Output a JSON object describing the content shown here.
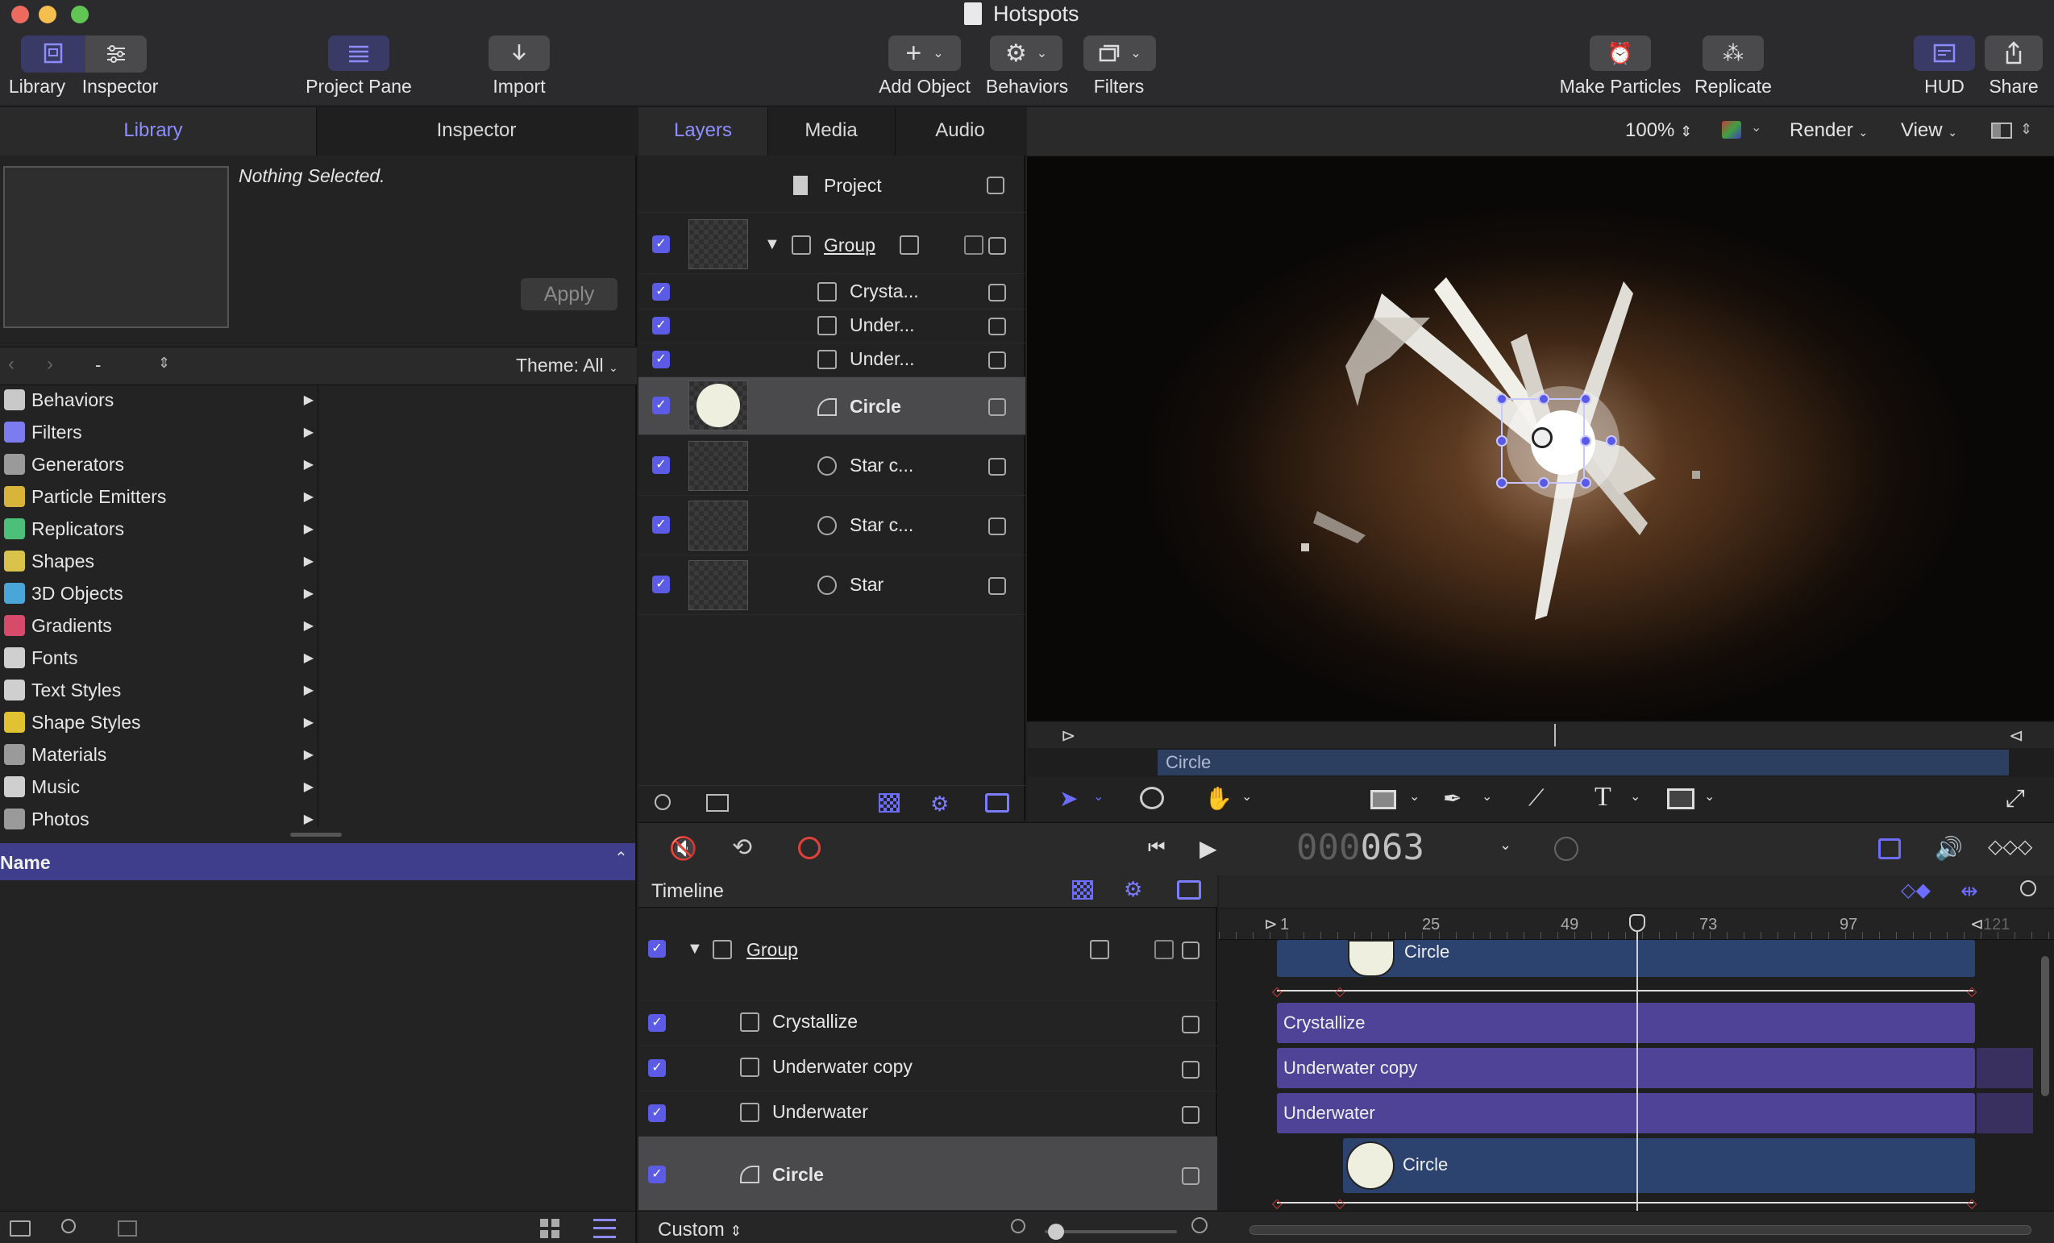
{
  "window": {
    "title": "Hotspots"
  },
  "toolbar": {
    "library": "Library",
    "inspector": "Inspector",
    "project_pane": "Project Pane",
    "import": "Import",
    "add_object": "Add Object",
    "behaviors": "Behaviors",
    "filters": "Filters",
    "make_particles": "Make Particles",
    "replicate": "Replicate",
    "hud": "HUD",
    "share": "Share"
  },
  "left_tabs": {
    "library": "Library",
    "inspector": "Inspector"
  },
  "preview": {
    "status": "Nothing Selected.",
    "apply": "Apply"
  },
  "browser": {
    "path": "-",
    "theme": "Theme: All"
  },
  "library_items": [
    {
      "label": "Behaviors",
      "icon": "gear-icon",
      "color": "#c9c9c9"
    },
    {
      "label": "Filters",
      "icon": "filter-icon",
      "color": "#7c7cf0"
    },
    {
      "label": "Generators",
      "icon": "generator-icon",
      "color": "#9a9a9a"
    },
    {
      "label": "Particle Emitters",
      "icon": "emitter-icon",
      "color": "#d8b43a"
    },
    {
      "label": "Replicators",
      "icon": "replicator-icon",
      "color": "#4cbf7a"
    },
    {
      "label": "Shapes",
      "icon": "shape-icon",
      "color": "#d8c24a"
    },
    {
      "label": "3D Objects",
      "icon": "cube-icon",
      "color": "#4aa6d8"
    },
    {
      "label": "Gradients",
      "icon": "gradient-icon",
      "color": "#d84a6a"
    },
    {
      "label": "Fonts",
      "icon": "font-icon",
      "color": "#cfcfcf"
    },
    {
      "label": "Text Styles",
      "icon": "text-style-icon",
      "color": "#cfcfcf"
    },
    {
      "label": "Shape Styles",
      "icon": "shape-style-icon",
      "color": "#e0c232"
    },
    {
      "label": "Materials",
      "icon": "material-icon",
      "color": "#9a9a9a"
    },
    {
      "label": "Music",
      "icon": "music-icon",
      "color": "#cfcfcf"
    },
    {
      "label": "Photos",
      "icon": "photo-icon",
      "color": "#9a9a9a"
    }
  ],
  "file_list": {
    "name_header": "Name"
  },
  "mid_tabs": {
    "layers": "Layers",
    "media": "Media",
    "audio": "Audio"
  },
  "layers": {
    "project": "Project",
    "group": "Group",
    "rows": [
      {
        "name": "Crysta..."
      },
      {
        "name": "Under..."
      },
      {
        "name": "Under..."
      },
      {
        "name": "Circle"
      },
      {
        "name": "Star c..."
      },
      {
        "name": "Star c..."
      },
      {
        "name": "Star"
      }
    ]
  },
  "canvas": {
    "zoom": "100%",
    "render": "Render",
    "view": "View",
    "mini_track": "Circle"
  },
  "transport": {
    "timecode_dim": "000",
    "timecode": "063",
    "custom": "Custom"
  },
  "timeline": {
    "title": "Timeline",
    "ruler": [
      "1",
      "25",
      "49",
      "73",
      "97",
      "121"
    ],
    "rows": [
      {
        "name": "Group"
      },
      {
        "name": "Crystallize"
      },
      {
        "name": "Underwater copy"
      },
      {
        "name": "Underwater"
      },
      {
        "name": "Circle"
      }
    ],
    "bars": [
      "Circle",
      "Crystallize",
      "Underwater copy",
      "Underwater",
      "Circle"
    ]
  }
}
